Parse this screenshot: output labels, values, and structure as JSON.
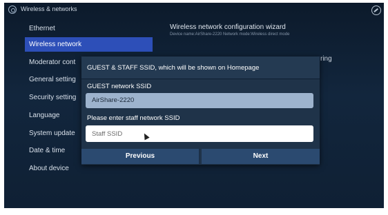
{
  "topbar": {
    "title": "Wireless & networks"
  },
  "sidebar": {
    "items": [
      {
        "label": "Ethernet"
      },
      {
        "label": "Wireless network"
      },
      {
        "label": "Moderator cont"
      },
      {
        "label": "General setting"
      },
      {
        "label": "Security setting"
      },
      {
        "label": "Language"
      },
      {
        "label": "System update"
      },
      {
        "label": "Date & time"
      },
      {
        "label": "About device"
      }
    ]
  },
  "main": {
    "wizard_title": "Wireless network configuration wizard",
    "wizard_subtitle": "Device name:AirShare-2220   Network mode:Wireless direct mode",
    "partial_text": "ring"
  },
  "dialog": {
    "title": "GUEST & STAFF SSID, which will be shown on Homepage",
    "guest_label": "GUEST network SSID",
    "guest_value": "AirShare-2220",
    "staff_label": "Please enter staff network SSID",
    "staff_placeholder": "Staff SSID",
    "previous_label": "Previous",
    "next_label": "Next"
  },
  "colors": {
    "selected_item": "#2d4fb8",
    "dialog_bg": "#1f3349",
    "button_bg": "#2b4a70"
  },
  "icons": [
    "app-icon",
    "settings-icon",
    "mouse-cursor-icon"
  ]
}
